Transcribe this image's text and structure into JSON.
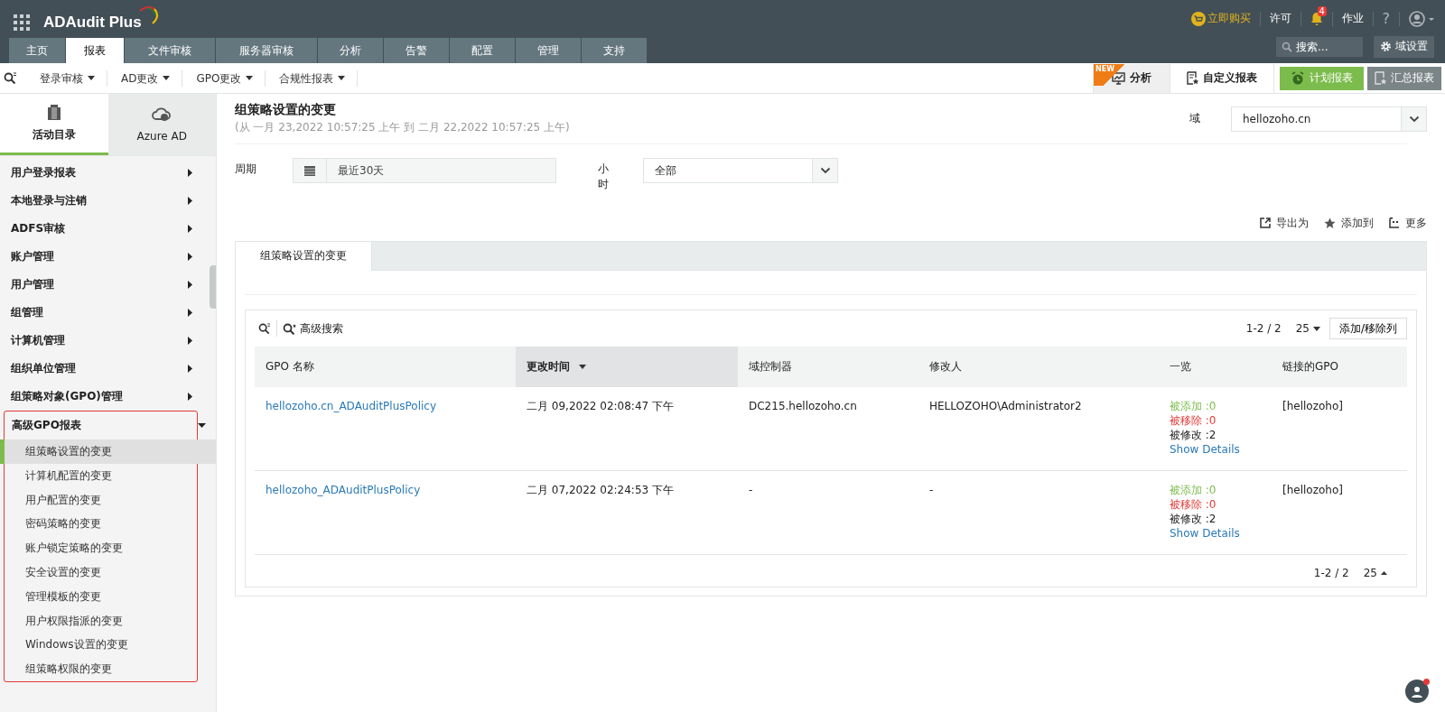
{
  "header": {
    "app_name": "ADAudit Plus",
    "buy": "立即购买",
    "license": "许可",
    "alert_count": "4",
    "jobs": "作业",
    "help": "?",
    "search_placeholder": "搜索...",
    "domain_settings": "域设置"
  },
  "nav_tabs": [
    {
      "label": "主页",
      "selected": false
    },
    {
      "label": "报表",
      "selected": true
    },
    {
      "label": "文件审核",
      "selected": false
    },
    {
      "label": "服务器审核",
      "selected": false
    },
    {
      "label": "分析",
      "selected": false
    },
    {
      "label": "告警",
      "selected": false
    },
    {
      "label": "配置",
      "selected": false
    },
    {
      "label": "管理",
      "selected": false
    },
    {
      "label": "支持",
      "selected": false
    }
  ],
  "sub_menu": [
    "登录审核",
    "AD更改",
    "GPO更改",
    "合规性报表"
  ],
  "view_buttons": [
    {
      "label": "分析",
      "kind": "analytics",
      "badge": "NEW"
    },
    {
      "label": "自定义报表",
      "kind": "custom"
    },
    {
      "label": "计划报表",
      "kind": "schedule"
    },
    {
      "label": "汇总报表",
      "kind": "summary"
    }
  ],
  "sidebar": {
    "source_tabs": [
      {
        "label": "活动目录",
        "kind": "ad",
        "selected": true
      },
      {
        "label": "Azure AD",
        "kind": "azure",
        "selected": false
      }
    ],
    "categories": [
      {
        "label": "用户登录报表",
        "expanded": false
      },
      {
        "label": "本地登录与注销",
        "expanded": false
      },
      {
        "label": "ADFS审核",
        "expanded": false
      },
      {
        "label": "账户管理",
        "expanded": false
      },
      {
        "label": "用户管理",
        "expanded": false
      },
      {
        "label": "组管理",
        "expanded": false
      },
      {
        "label": "计算机管理",
        "expanded": false
      },
      {
        "label": "组织单位管理",
        "expanded": false
      },
      {
        "label": "组策略对象(GPO)管理",
        "expanded": false
      },
      {
        "label": "高级GPO报表",
        "expanded": true,
        "children": [
          {
            "label": "组策略设置的变更",
            "selected": true
          },
          {
            "label": "计算机配置的变更",
            "selected": false
          },
          {
            "label": "用户配置的变更",
            "selected": false
          },
          {
            "label": "密码策略的变更",
            "selected": false
          },
          {
            "label": "账户锁定策略的变更",
            "selected": false
          },
          {
            "label": "安全设置的变更",
            "selected": false
          },
          {
            "label": "管理模板的变更",
            "selected": false
          },
          {
            "label": "用户权限指派的变更",
            "selected": false
          },
          {
            "label": "Windows设置的变更",
            "selected": false
          },
          {
            "label": "组策略权限的变更",
            "selected": false
          }
        ]
      }
    ]
  },
  "report": {
    "title": "组策略设置的变更",
    "range": "(从 一月 23,2022 10:57:25 上午 到 二月 22,2022 10:57:25 上午)",
    "domain_label": "域",
    "domain_value": "hellozoho.cn",
    "period_label": "周期",
    "period_value": "最近30天",
    "hour_label": "小时",
    "hour_value": "全部",
    "actions": [
      {
        "label": "导出为",
        "kind": "export"
      },
      {
        "label": "添加到",
        "kind": "favorite"
      },
      {
        "label": "更多",
        "kind": "more"
      }
    ],
    "tab": "组策略设置的变更",
    "advanced_search": "高级搜索",
    "pagination": "1-2 / 2",
    "page_size": "25",
    "columns_button": "添加/移除列",
    "columns": [
      {
        "label": "GPO 名称",
        "sorted": false
      },
      {
        "label": "更改时间",
        "sorted": true
      },
      {
        "label": "域控制器",
        "sorted": false
      },
      {
        "label": "修改人",
        "sorted": false
      },
      {
        "label": "一览",
        "sorted": false
      },
      {
        "label": "链接的GPO",
        "sorted": false
      }
    ],
    "rows": [
      {
        "gpo": "hellozoho.cn_ADAuditPlusPolicy",
        "time": "二月 09,2022 02:08:47 下午",
        "dc": "DC215.hellozoho.cn",
        "modifier": "HELLOZOHO\\Administrator2",
        "summary": [
          {
            "text": "被添加 :0",
            "kind": "added"
          },
          {
            "text": "被移除 :0",
            "kind": "removed"
          },
          {
            "text": "被修改 :2",
            "kind": "modified"
          },
          {
            "text": "Show Details",
            "kind": "link"
          }
        ],
        "linked": "[hellozoho]"
      },
      {
        "gpo": "hellozoho_ADAuditPlusPolicy",
        "time": "二月 07,2022 02:24:53 下午",
        "dc": "-",
        "modifier": "-",
        "summary": [
          {
            "text": "被添加 :0",
            "kind": "added"
          },
          {
            "text": "被移除 :0",
            "kind": "removed"
          },
          {
            "text": "被修改 :2",
            "kind": "modified"
          },
          {
            "text": "Show Details",
            "kind": "link"
          }
        ],
        "linked": "[hellozoho]"
      }
    ],
    "footer_pagination": "1-2 / 2",
    "footer_page_size": "25"
  }
}
